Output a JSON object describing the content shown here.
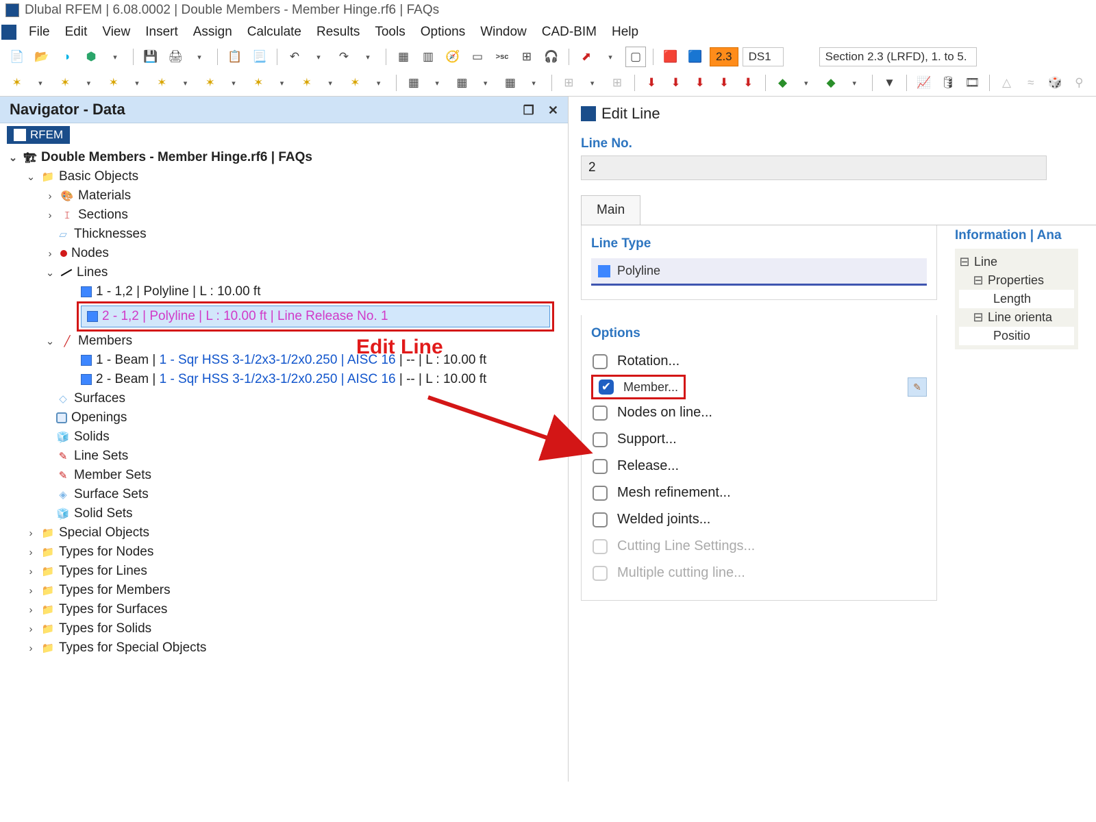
{
  "title": "Dlubal RFEM | 6.08.0002 | Double Members - Member Hinge.rf6 | FAQs",
  "menu": [
    "File",
    "Edit",
    "View",
    "Insert",
    "Assign",
    "Calculate",
    "Results",
    "Tools",
    "Options",
    "Window",
    "CAD-BIM",
    "Help"
  ],
  "toolbar1": {
    "version_box": "2.3",
    "combo1": "DS1",
    "combo2": "Section 2.3 (LRFD), 1. to 5."
  },
  "navigator": {
    "title": "Navigator - Data",
    "root": "RFEM",
    "project": "Double Members - Member Hinge.rf6 | FAQs",
    "basic_objects": "Basic Objects",
    "materials": "Materials",
    "sections": "Sections",
    "thicknesses": "Thicknesses",
    "nodes": "Nodes",
    "lines": "Lines",
    "line1": "1 - 1,2 | Polyline | L : 10.00 ft",
    "line2": "2 - 1,2 | Polyline | L : 10.00 ft | Line Release No. 1",
    "members": "Members",
    "member1_a": "1 - Beam | ",
    "member1_b": "1 - Sqr HSS 3-1/2x3-1/2x0.250 | AISC 16",
    "member1_c": " | -- | L : 10.00 ft",
    "member2_a": "2 - Beam | ",
    "member2_b": "1 - Sqr HSS 3-1/2x3-1/2x0.250 | AISC 16",
    "member2_c": " | -- | L : 10.00 ft",
    "surfaces": "Surfaces",
    "openings": "Openings",
    "solids": "Solids",
    "line_sets": "Line Sets",
    "member_sets": "Member Sets",
    "surface_sets": "Surface Sets",
    "solid_sets": "Solid Sets",
    "special_objects": "Special Objects",
    "types_nodes": "Types for Nodes",
    "types_lines": "Types for Lines",
    "types_members": "Types for Members",
    "types_surfaces": "Types for Surfaces",
    "types_solids": "Types for Solids",
    "types_special": "Types for Special Objects"
  },
  "annotation": "Edit Line",
  "edit_line": {
    "title": "Edit Line",
    "line_no_label": "Line No.",
    "line_no_value": "2",
    "tab_main": "Main",
    "line_type_hdr": "Line Type",
    "line_type_value": "Polyline",
    "options_hdr": "Options",
    "rotation": "Rotation...",
    "member": "Member...",
    "nodes_on_line": "Nodes on line...",
    "support": "Support...",
    "release": "Release...",
    "mesh": "Mesh refinement...",
    "welded": "Welded joints...",
    "cut_settings": "Cutting Line Settings...",
    "multi_cut": "Multiple cutting line..."
  },
  "info": {
    "header": "Information | Ana",
    "line": "Line",
    "properties": "Properties",
    "length": "Length",
    "orientation": "Line orienta",
    "position": "Positio"
  }
}
